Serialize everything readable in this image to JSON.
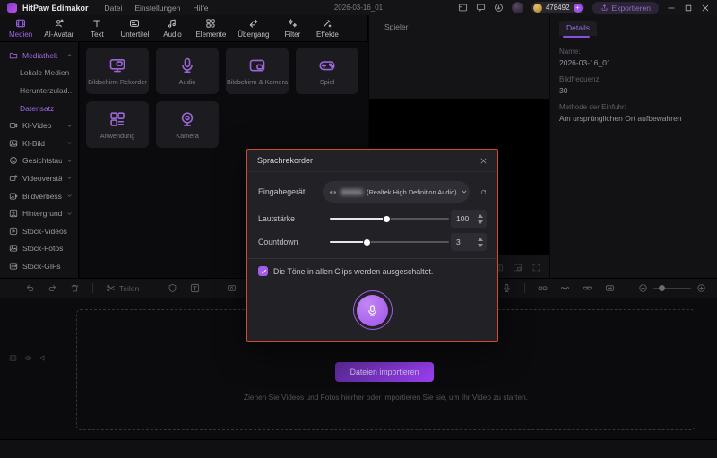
{
  "titlebar": {
    "app_name": "HitPaw Edimakor",
    "menus": [
      {
        "label": "Datei"
      },
      {
        "label": "Einstellungen"
      },
      {
        "label": "Hilfe"
      }
    ],
    "project_title": "2026-03-16_01",
    "coins": "478492",
    "export_label": "Exportieren",
    "icons": [
      "layout-icon",
      "feedback-icon",
      "download-icon",
      "avatar",
      "coin-icon",
      "add-coins-icon",
      "export-icon",
      "minimize-icon",
      "maximize-icon",
      "close-icon"
    ]
  },
  "ribbon": {
    "tabs": [
      {
        "label": "Medien",
        "icon": "media-icon",
        "active": true
      },
      {
        "label": "AI-Avatar",
        "icon": "avatar-icon"
      },
      {
        "label": "Text",
        "icon": "text-icon"
      },
      {
        "label": "Untertitel",
        "icon": "subtitle-icon"
      },
      {
        "label": "Audio",
        "icon": "audio-icon"
      },
      {
        "label": "Elemente",
        "icon": "elements-icon"
      },
      {
        "label": "Übergang",
        "icon": "transition-icon"
      },
      {
        "label": "Filter",
        "icon": "filter-icon"
      },
      {
        "label": "Effekte",
        "icon": "effects-icon"
      }
    ]
  },
  "sidebar": {
    "items": [
      {
        "label": "Mediathek",
        "icon": "folder-icon",
        "expanded": true,
        "active": true
      },
      {
        "label": "Lokale Medien",
        "type": "sub"
      },
      {
        "label": "Herunterzulad...",
        "type": "sub"
      },
      {
        "label": "Datensatz",
        "type": "sub",
        "active": true
      },
      {
        "label": "KI-Video",
        "icon": "ai-video-icon"
      },
      {
        "label": "KI-Bild",
        "icon": "ai-image-icon"
      },
      {
        "label": "Gesichtstausch",
        "icon": "face-swap-icon"
      },
      {
        "label": "Videoverstärk...",
        "icon": "video-enhance-icon"
      },
      {
        "label": "Bildverbesser...",
        "icon": "image-enhance-icon"
      },
      {
        "label": "Hintergrund",
        "icon": "background-icon"
      },
      {
        "label": "Stock-Videos",
        "icon": "stock-video-icon"
      },
      {
        "label": "Stock-Fotos",
        "icon": "stock-photo-icon"
      },
      {
        "label": "Stock-GIFs",
        "icon": "stock-gif-icon"
      }
    ]
  },
  "media_library": {
    "cards": [
      {
        "label": "Bildschirm Rekorder",
        "icon": "screen-recorder-icon"
      },
      {
        "label": "Audio",
        "icon": "microphone-icon"
      },
      {
        "label": "Bildschirm & Kamera",
        "icon": "screen-camera-icon"
      },
      {
        "label": "Spiel",
        "icon": "gamepad-icon"
      },
      {
        "label": "Anwendung",
        "icon": "application-icon"
      },
      {
        "label": "Kamera",
        "icon": "webcam-icon"
      }
    ]
  },
  "player": {
    "title": "Spieler",
    "icons": [
      "snapshot-icon",
      "mini-player-icon",
      "fullscreen-icon"
    ]
  },
  "details_panel": {
    "tab": "Details",
    "fields": [
      {
        "label": "Name:",
        "value": "2026-03-16_01"
      },
      {
        "label": "Bildfrequenz:",
        "value": "30"
      },
      {
        "label": "Methode der Einfuhr:",
        "value": "Am ursprünglichen Ort aufbewahren"
      }
    ]
  },
  "timeline_toolbar": {
    "split_label": "Teilen",
    "icons": [
      "undo-icon",
      "redo-icon",
      "delete-icon",
      "split-icon",
      "crop-icon",
      "quick-text-icon",
      "record-icon",
      "voiceover-mic-icon",
      "detach-audio-icon",
      "keyframe-icon",
      "link-icon",
      "fit-timeline-icon",
      "zoom-out-icon",
      "zoom-in-icon"
    ]
  },
  "timeline": {
    "import_button": "Dateien importieren",
    "hint": "Ziehen Sie Videos und Fotos hierher oder importieren Sie sie, um Ihr Video zu starten.",
    "track_icons": [
      "film-icon",
      "eye-icon",
      "volume-icon"
    ]
  },
  "voice_recorder_dialog": {
    "title": "Sprachrekorder",
    "input_device_label": "Eingabegerät",
    "input_device_value": "(Realtek High Definition Audio)",
    "volume_label": "Lautstärke",
    "volume_value": "100",
    "volume_percent": 48,
    "countdown_label": "Countdown",
    "countdown_value": "3",
    "countdown_percent": 31,
    "mute_checkbox_label": "Die Töne in allen Clips werden ausgeschaltet.",
    "mute_checkbox_checked": true,
    "icons": [
      "waveform-icon",
      "chevron-down-icon",
      "refresh-icon",
      "close-icon",
      "microphone-record-button"
    ]
  },
  "colors": {
    "accent_purple": "#9d5fe8",
    "highlight_border": "#cf4b32",
    "import_gradient": [
      "#5f2b9e",
      "#9a3ff0"
    ],
    "mic_button": "#a85ce8",
    "coin_gold": "#d4a14a"
  }
}
